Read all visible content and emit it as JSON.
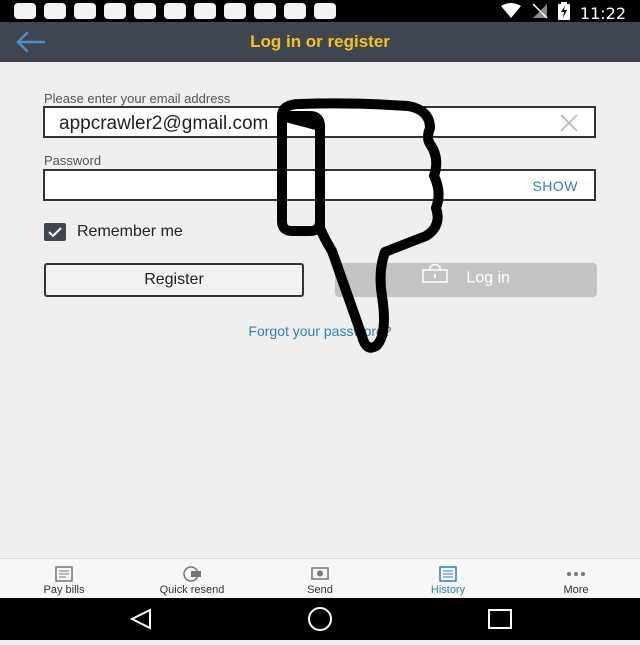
{
  "status": {
    "time": "11:22"
  },
  "appbar": {
    "title": "Log in or register"
  },
  "form": {
    "email_label": "Please enter your email address",
    "email_value": "appcrawler2@gmail.com",
    "password_label": "Password",
    "password_value": "",
    "show_label": "SHOW",
    "remember_label": "Remember me",
    "remember_checked": true,
    "register_label": "Register",
    "login_label": "Log in",
    "forgot_label": "Forgot your password?"
  },
  "tabs": [
    {
      "label": "Pay bills",
      "icon": "pay-bills-icon"
    },
    {
      "label": "Quick resend",
      "icon": "quick-resend-icon"
    },
    {
      "label": "Send",
      "icon": "send-icon"
    },
    {
      "label": "History",
      "icon": "history-icon",
      "active": true
    },
    {
      "label": "More",
      "icon": "more-icon"
    }
  ],
  "colors": {
    "appbar": "#3f4650",
    "accent": "#f6c21a",
    "link": "#2f7fb8"
  }
}
